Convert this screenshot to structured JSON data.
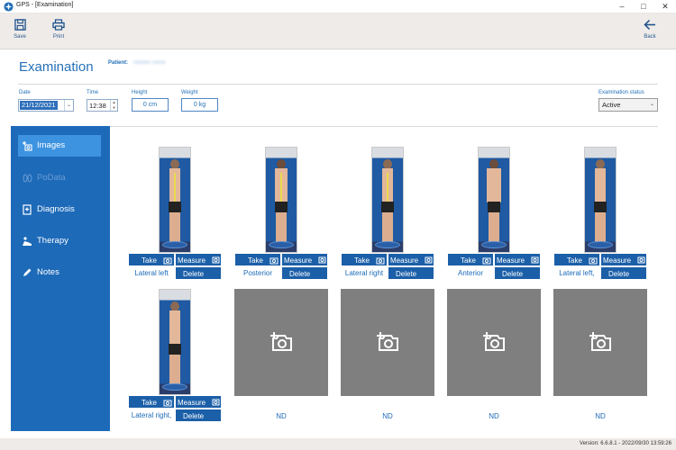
{
  "window": {
    "title": "GPS - [Examination]"
  },
  "toolbar": {
    "save_label": "Save",
    "print_label": "Print",
    "back_label": "Back"
  },
  "header": {
    "title": "Examination",
    "patient_label": "Patient:",
    "patient_name": "Hidden name"
  },
  "fields": {
    "date_label": "Date",
    "date_value": "21/12/2021",
    "time_label": "Time",
    "time_value": "12:38",
    "height_label": "Height",
    "height_value": "0 cm",
    "weight_label": "Weight",
    "weight_value": "0 kg",
    "status_label": "Examination status",
    "status_value": "Active"
  },
  "sidebar": {
    "items": [
      {
        "label": "Images",
        "state": "active"
      },
      {
        "label": "PoData",
        "state": "disabled"
      },
      {
        "label": "Diagnosis",
        "state": "normal"
      },
      {
        "label": "Therapy",
        "state": "normal"
      },
      {
        "label": "Notes",
        "state": "normal"
      }
    ]
  },
  "images": {
    "take_label": "Take",
    "measure_label": "Measure",
    "delete_label": "Delete",
    "items": [
      {
        "label": "Lateral left",
        "has_image": true
      },
      {
        "label": "Posterior",
        "has_image": true
      },
      {
        "label": "Lateral right",
        "has_image": true
      },
      {
        "label": "Anterior",
        "has_image": true
      },
      {
        "label": "Lateral left,",
        "has_image": true
      },
      {
        "label": "Lateral right,",
        "has_image": true
      },
      {
        "label": "ND",
        "has_image": false
      },
      {
        "label": "ND",
        "has_image": false
      },
      {
        "label": "ND",
        "has_image": false
      },
      {
        "label": "ND",
        "has_image": false
      }
    ]
  },
  "colors": {
    "accent": "#1d6ab9",
    "active": "#3d93e0",
    "placeholder": "#7f7f7f"
  },
  "footer": {
    "version": "Version: 6.6.8.1 - 2022/09/30 13:59:26"
  }
}
